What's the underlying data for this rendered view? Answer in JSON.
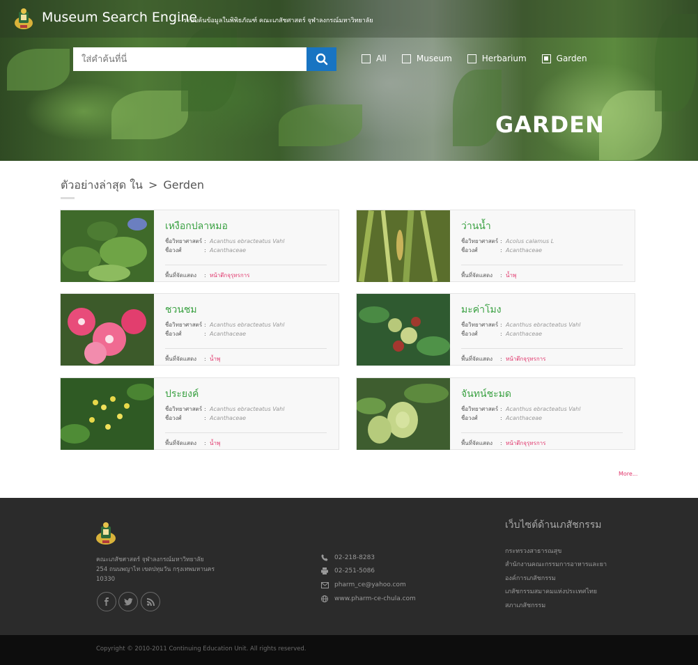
{
  "header": {
    "title": "Museum Search Engine",
    "subtitle": "- ระบบค้นข้อมูลในพิพิธภัณฑ์ คณะเภสัชศาสตร์ จุฬาลงกรณ์มหาวิทยาลัย",
    "logo_icon": "crest-logo"
  },
  "search": {
    "placeholder": "ใส่คำค้นที่นี่",
    "value": "",
    "button_icon": "search-icon"
  },
  "filters": [
    {
      "label": "All",
      "checked": false
    },
    {
      "label": "Museum",
      "checked": false
    },
    {
      "label": "Herbarium",
      "checked": false
    },
    {
      "label": "Garden",
      "checked": true
    }
  ],
  "hero": {
    "heading": "GARDEN"
  },
  "section": {
    "title_prefix": "ตัวอย่างล่าสุด ใน",
    "separator": ">",
    "title_current": "Gerden"
  },
  "labels": {
    "scientific": "ชื่อวิทยาศาสตร์",
    "family": "ชื่อวงศ์",
    "location": "พื้นที่จัดแสดง",
    "colon": ":"
  },
  "cards": [
    {
      "name": "เหงือกปลาหมอ",
      "scientific": "Acanthus ebracteatus Vahl",
      "family": "Acanthaceae",
      "location": "หน้าตึกจุรุทรการ",
      "image": "blue-flower-leaves"
    },
    {
      "name": "ว่านน้ำ",
      "scientific": "Acolus calamus L",
      "family": "Acanthaceae",
      "location": "น้ำพุ",
      "image": "calamus-grass"
    },
    {
      "name": "ชวนชม",
      "scientific": "Acanthus ebracteatus Vahl",
      "family": "Acanthaceae",
      "location": "น้ำพุ",
      "image": "pink-adenium"
    },
    {
      "name": "มะค่าโมง",
      "scientific": "Acanthus ebracteatus Vahl",
      "family": "Acanthaceae",
      "location": "หน้าตึกจุรุทรการ",
      "image": "green-blossom"
    },
    {
      "name": "ประยงค์",
      "scientific": "Acanthus ebracteatus Vahl",
      "family": "Acanthaceae",
      "location": "น้ำพุ",
      "image": "yellow-aglaia"
    },
    {
      "name": "จันทน์ชะมด",
      "scientific": "Acanthus ebracteatus Vahl",
      "family": "Acanthaceae",
      "location": "หน้าตึกจุรุทรการ",
      "image": "green-fruit"
    }
  ],
  "more": "More...",
  "footer": {
    "address": [
      "คณะเภสัชศาสตร์ จุฬาลงกรณ์มหาวิทยาลัย",
      "254 ถนนพญาไท เขตปทุมวัน กรุงเทพมหานคร",
      "10330"
    ],
    "social": [
      {
        "icon": "facebook-icon",
        "glyph": "f"
      },
      {
        "icon": "twitter-icon",
        "glyph": "t"
      },
      {
        "icon": "rss-icon",
        "glyph": "rss"
      }
    ],
    "contacts": [
      {
        "icon": "phone-icon",
        "text": "02-218-8283"
      },
      {
        "icon": "fax-icon",
        "text": "02-251-5086"
      },
      {
        "icon": "mail-icon",
        "text": "pharm_ce@yahoo.com"
      },
      {
        "icon": "globe-icon",
        "text": "www.pharm-ce-chula.com"
      }
    ],
    "links_title": "เว็บไซต์ด้านเภสัชกรรม",
    "links": [
      "กระทรวงสาธารณสุข",
      "สำนักงานคณะกรรมการอาหารและยา",
      "องค์การเภสัชกรรม",
      "เภสัชกรรมสมาคมแห่งประเทศไทย",
      "สภาเภสัชกรรม"
    ],
    "copyright": "Copyright © 2010-2011 Continuing Education Unit. All rights reserved."
  },
  "colors": {
    "accent_blue": "#1874c2",
    "name_green": "#3aa142",
    "link_pink": "#e0346a",
    "footer_bg": "#2b2b2b"
  }
}
